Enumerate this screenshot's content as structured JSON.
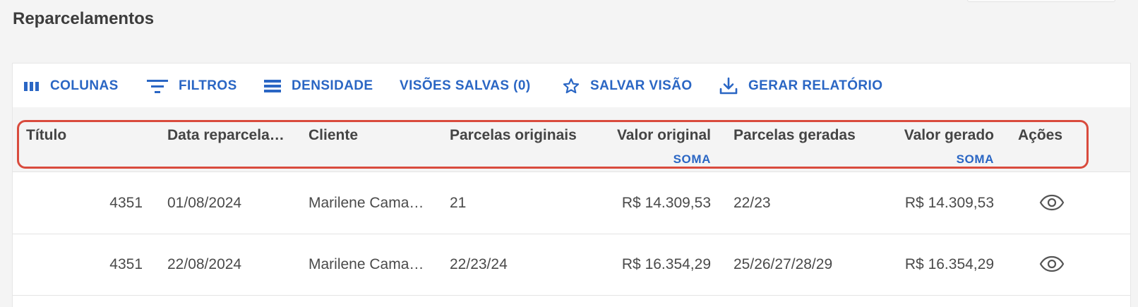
{
  "page": {
    "title": "Reparcelamentos"
  },
  "toolbar": {
    "columns_label": "COLUNAS",
    "filters_label": "FILTROS",
    "density_label": "DENSIDADE",
    "saved_views_label": "VISÕES SALVAS (0)",
    "save_view_label": "SALVAR VISÃO",
    "report_label": "GERAR RELATÓRIO"
  },
  "table": {
    "columns": [
      {
        "label": "Título"
      },
      {
        "label": "Data reparcelamento"
      },
      {
        "label": "Cliente"
      },
      {
        "label": "Parcelas originais"
      },
      {
        "label": "Valor original",
        "aggregate": "SOMA"
      },
      {
        "label": "Parcelas geradas"
      },
      {
        "label": "Valor gerado",
        "aggregate": "SOMA"
      },
      {
        "label": "Ações"
      }
    ],
    "rows": [
      {
        "titulo": "4351",
        "data": "01/08/2024",
        "cliente": "Marilene Camargo",
        "parcelas_originais": "21",
        "valor_original": "R$ 14.309,53",
        "parcelas_geradas": "22/23",
        "valor_gerado": "R$ 14.309,53",
        "action_icon": "eye-icon"
      },
      {
        "titulo": "4351",
        "data": "22/08/2024",
        "cliente": "Marilene Camargo",
        "parcelas_originais": "22/23/24",
        "valor_original": "R$ 16.354,29",
        "parcelas_geradas": "25/26/27/28/29",
        "valor_gerado": "R$ 16.354,29",
        "action_icon": "eye-icon"
      }
    ]
  },
  "colors": {
    "accent": "#2a66c4",
    "highlight": "#d94b3d"
  }
}
